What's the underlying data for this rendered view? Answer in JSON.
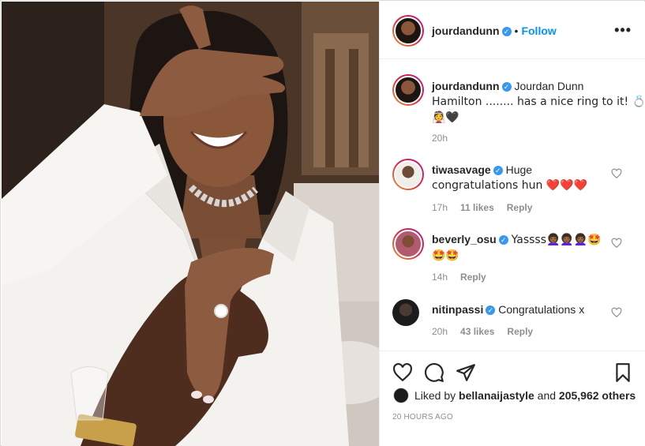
{
  "post": {
    "username": "jourdandunn",
    "follow_label": "Follow",
    "separator": "•",
    "more_label": "•••"
  },
  "caption": {
    "username": "jourdandunn",
    "text_line1": "Jourdan Dunn",
    "text_line2": "Hamilton ........ has a nice ring to it! 💍",
    "text_line3": "👰🖤",
    "time": "20h"
  },
  "comments": [
    {
      "username": "tiwasavage",
      "text_line1": "Huge",
      "text_line2": "congratulations hun ❤️❤️❤️",
      "time": "17h",
      "likes": "11 likes",
      "reply": "Reply"
    },
    {
      "username": "beverly_osu",
      "text_line1": "Yassss👩🏾‍🦱👩🏾‍🦱👩🏾‍🦱🤩",
      "text_line2": "🤩🤩",
      "time": "14h",
      "reply": "Reply"
    },
    {
      "username": "nitinpassi",
      "text_line1": "Congratulations x",
      "text_line2": "",
      "time": "20h",
      "likes": "43 likes",
      "reply": "Reply"
    }
  ],
  "likes_summary": {
    "prefix": "Liked by",
    "user": "bellanaijastyle",
    "conj": "and",
    "count": "205,962 others"
  },
  "timestamp": "20 HOURS AGO",
  "colors": {
    "accent": "#0095f6",
    "verified": "#3897f0",
    "heart": "#ed4956",
    "muted": "#8e8e8e"
  },
  "icons": [
    "heart-icon",
    "comment-icon",
    "share-icon",
    "bookmark-icon",
    "verified-icon",
    "more-icon"
  ]
}
